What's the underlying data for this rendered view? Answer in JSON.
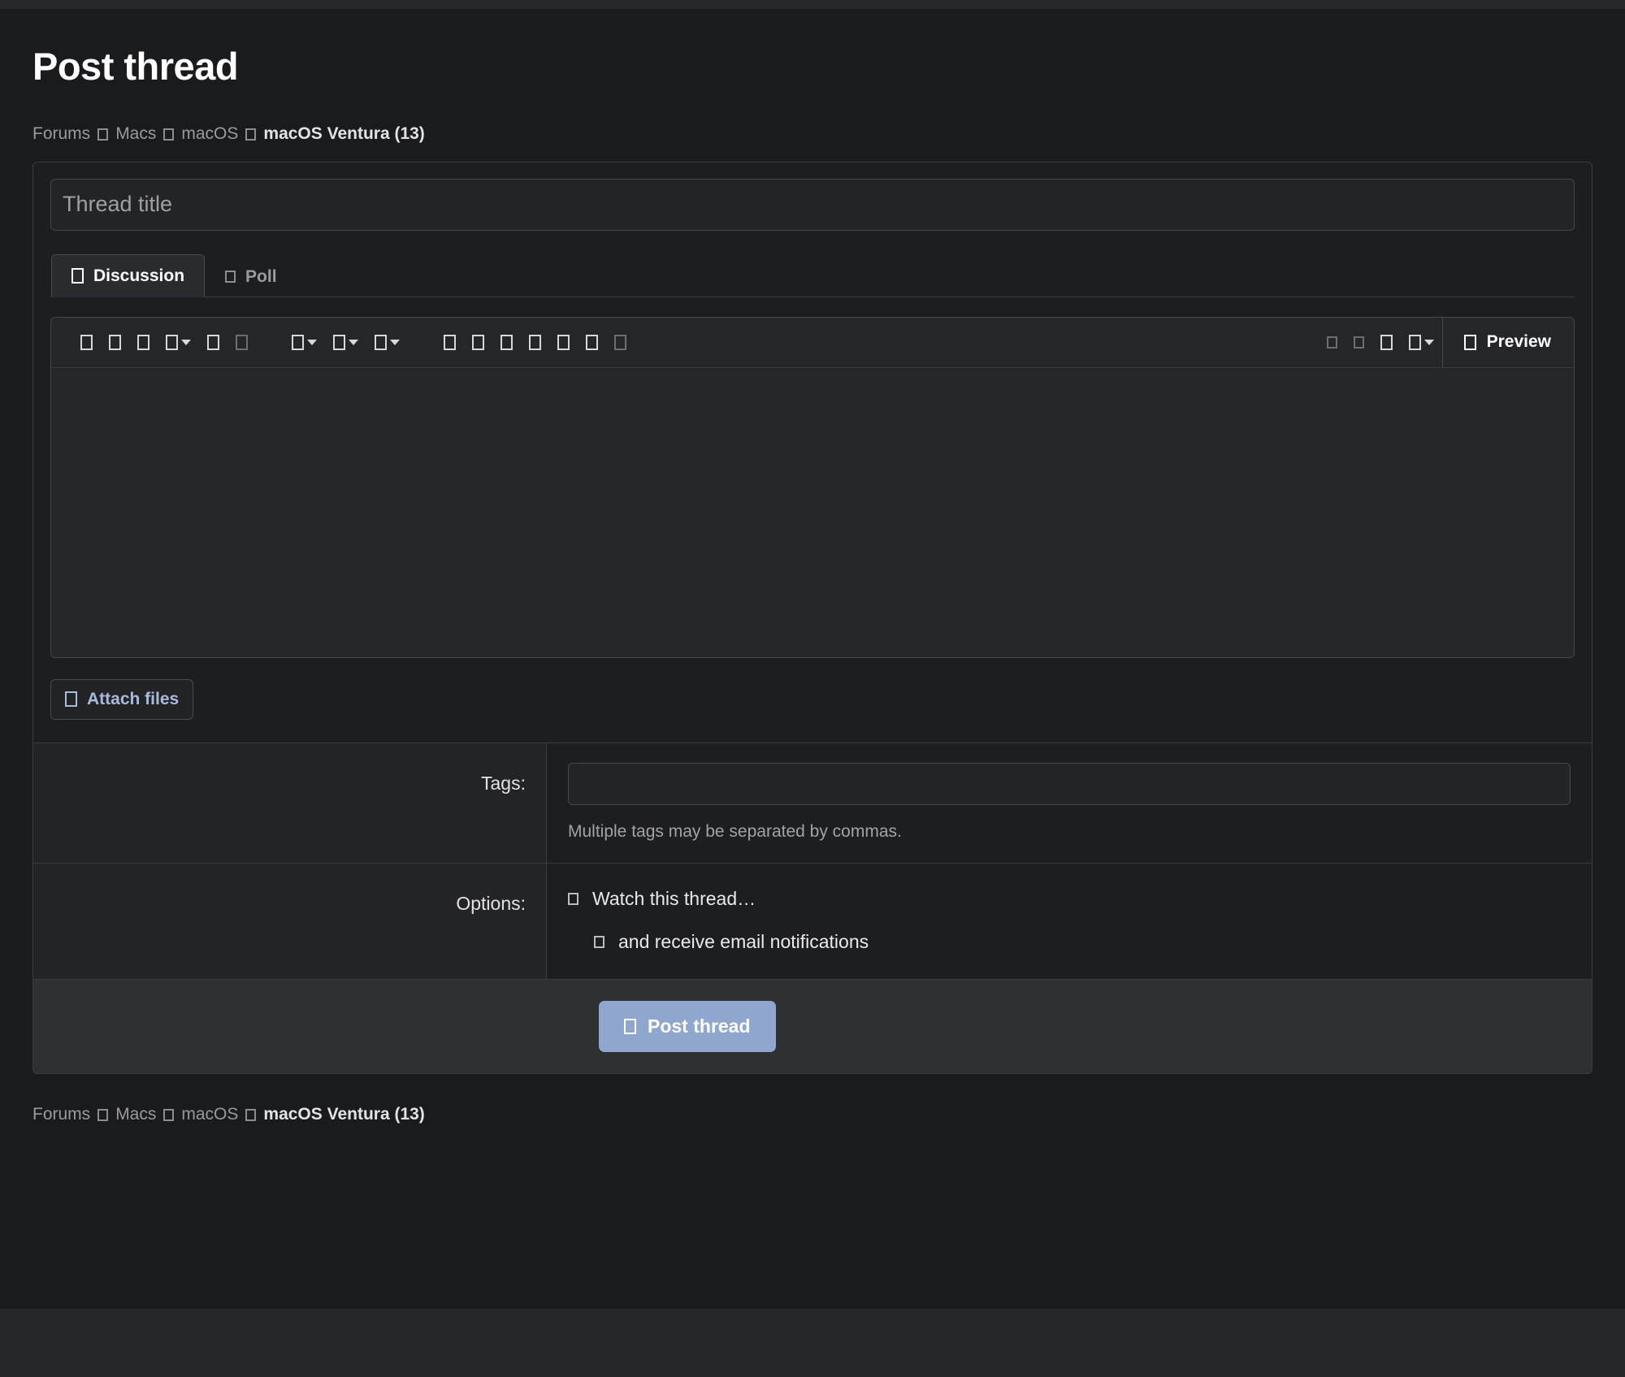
{
  "page": {
    "title": "Post thread"
  },
  "breadcrumb": {
    "separator_icon": "chevron-right-icon",
    "items": [
      {
        "label": "Forums"
      },
      {
        "label": "Macs"
      },
      {
        "label": "macOS"
      },
      {
        "label": "macOS Ventura (13)"
      }
    ]
  },
  "form": {
    "thread_title": {
      "value": "",
      "placeholder": "Thread title"
    },
    "tabs": [
      {
        "label": "Discussion",
        "icon": "comment-icon",
        "active": true
      },
      {
        "label": "Poll",
        "icon": "poll-icon",
        "active": false
      }
    ],
    "editor": {
      "content": "",
      "toolbar_groups": [
        [
          {
            "icon": "bold-icon",
            "dropdown": false,
            "disabled": false
          },
          {
            "icon": "italic-icon",
            "dropdown": false,
            "disabled": false
          },
          {
            "icon": "underline-icon",
            "dropdown": false,
            "disabled": false
          },
          {
            "icon": "text-color-icon",
            "dropdown": true,
            "disabled": false
          },
          {
            "icon": "font-size-icon",
            "dropdown": false,
            "disabled": false
          },
          {
            "icon": "strikethrough-icon",
            "dropdown": false,
            "disabled": true
          }
        ],
        [
          {
            "icon": "text-align-icon",
            "dropdown": true,
            "disabled": false
          },
          {
            "icon": "list-icon",
            "dropdown": true,
            "disabled": false
          },
          {
            "icon": "indent-icon",
            "dropdown": true,
            "disabled": false
          }
        ],
        [
          {
            "icon": "link-icon",
            "dropdown": false,
            "disabled": false
          },
          {
            "icon": "image-icon",
            "dropdown": false,
            "disabled": false
          },
          {
            "icon": "quote-icon",
            "dropdown": false,
            "disabled": false
          },
          {
            "icon": "code-icon",
            "dropdown": false,
            "disabled": false
          },
          {
            "icon": "horizontal-rule-icon",
            "dropdown": false,
            "disabled": false
          },
          {
            "icon": "table-icon",
            "dropdown": false,
            "disabled": false
          },
          {
            "icon": "media-icon",
            "dropdown": false,
            "disabled": true
          }
        ]
      ],
      "toolbar_right": [
        {
          "icon": "undo-icon",
          "dropdown": false,
          "disabled": true
        },
        {
          "icon": "redo-icon",
          "dropdown": false,
          "disabled": true
        },
        {
          "icon": "draft-icon",
          "dropdown": false,
          "disabled": false
        },
        {
          "icon": "more-options-icon",
          "dropdown": true,
          "disabled": false
        }
      ],
      "preview_button": {
        "label": "Preview",
        "icon": "eye-icon"
      }
    },
    "attach_button": {
      "label": "Attach files",
      "icon": "paperclip-icon"
    },
    "tags": {
      "label": "Tags:",
      "value": "",
      "placeholder": "",
      "hint": "Multiple tags may be separated by commas."
    },
    "options": {
      "label": "Options:",
      "items": [
        {
          "label": "Watch this thread…",
          "icon": "checkbox-icon",
          "checked": false
        },
        {
          "label": "and receive email notifications",
          "icon": "checkbox-icon",
          "checked": false
        }
      ]
    },
    "submit_button": {
      "label": "Post thread",
      "icon": "send-icon"
    }
  },
  "colors": {
    "page_background": "#1a1b1d",
    "card_background": "#1d1e20",
    "field_background": "#232426",
    "accent_button": "#8fa7ce",
    "link_text": "#a9bbdd",
    "border": "#3a3b3e"
  }
}
